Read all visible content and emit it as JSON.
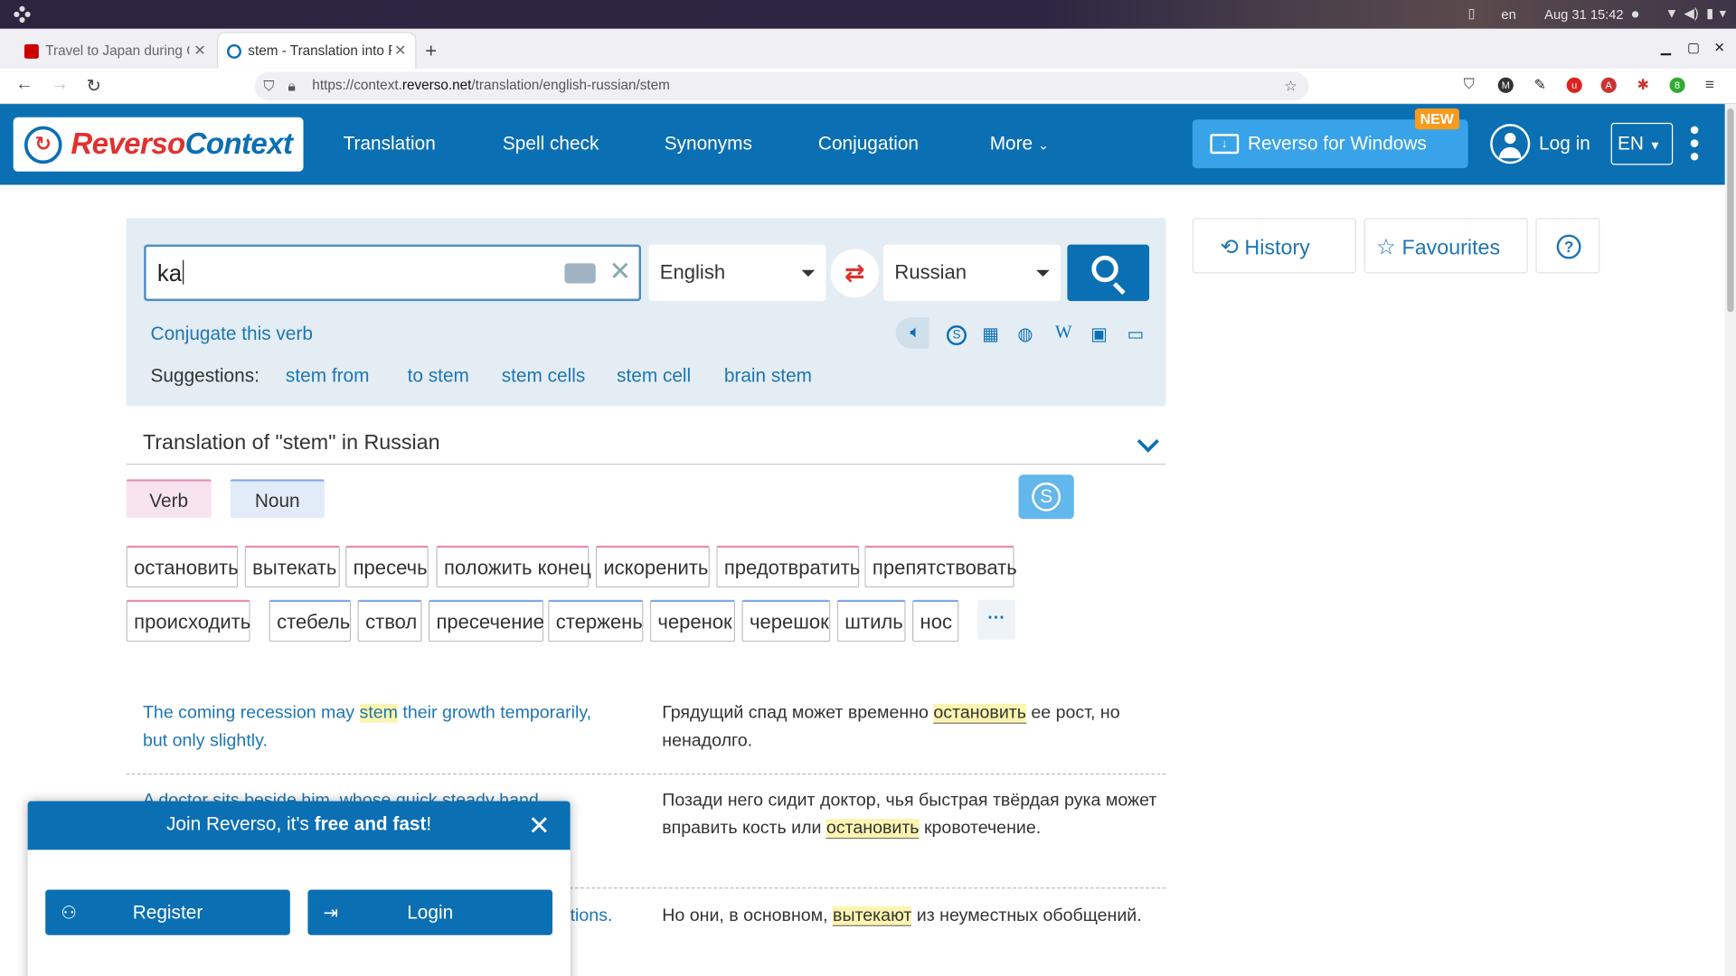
{
  "os": {
    "lang": "en",
    "datetime": "Aug 31  15:42"
  },
  "tabs": [
    {
      "title": "Travel to Japan during C"
    },
    {
      "title": "stem - Translation into R"
    }
  ],
  "url": {
    "prefix": "https://context.",
    "domain": "reverso.net",
    "path": "/translation/english-russian/stem"
  },
  "header": {
    "logo_a": "Reverso",
    "logo_b": "Context",
    "nav": [
      "Translation",
      "Spell check",
      "Synonyms",
      "Conjugation",
      "More"
    ],
    "windows_button": "Reverso for Windows",
    "new_badge": "NEW",
    "login": "Log in",
    "lang": "EN"
  },
  "search": {
    "value": "ka",
    "source_lang": "English",
    "target_lang": "Russian",
    "conjugate_link": "Conjugate this verb",
    "suggestions_label": "Suggestions:",
    "suggestions": [
      "stem from",
      "to stem",
      "stem cells",
      "stem cell",
      "brain stem"
    ]
  },
  "sidebar": {
    "history": "History",
    "favourites": "Favourites"
  },
  "translation": {
    "heading": "Translation of \"stem\" in Russian",
    "pos": [
      "Verb",
      "Noun"
    ],
    "row1": [
      "остановить",
      "вытекать",
      "пресечь",
      "положить конец",
      "искоренить",
      "предотвратить",
      "препятствовать"
    ],
    "row2": [
      "происходить",
      "стебель",
      "ствол",
      "пресечение",
      "стержень",
      "черенок",
      "черешок",
      "штиль",
      "нос"
    ],
    "more": "···"
  },
  "examples": [
    {
      "src_a": "The coming recession may ",
      "src_h": "stem",
      "src_b": " their growth temporarily, but only slightly.",
      "tgt_a": "Грядущий спад может временно ",
      "tgt_h": "остановить",
      "tgt_b": " ее рост, но ненадолго."
    },
    {
      "src_a": "A doctor sits beside him, whose quick steady hand",
      "src_h": "",
      "src_b": "",
      "tgt_a": "Позади него сидит доктор, чья быстрая твёрдая рука может вправить кость или ",
      "tgt_h": "остановить",
      "tgt_b": " кровотечение."
    },
    {
      "src_a": "tions.",
      "src_h": "",
      "src_b": "",
      "tgt_a": "Но они, в основном, ",
      "tgt_h": "вытекают",
      "tgt_b": " из неуместных обобщений."
    }
  ],
  "popup": {
    "title_a": "Join Reverso, it's ",
    "title_b": "free and fast",
    "title_c": "!",
    "register": "Register",
    "login": "Login"
  }
}
